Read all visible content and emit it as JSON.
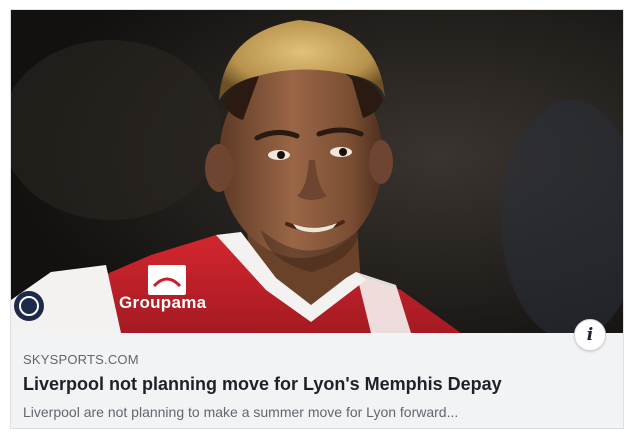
{
  "link_preview": {
    "domain": "SKYSPORTS.COM",
    "headline": "Liverpool not planning move for Lyon's Memphis Depay",
    "description": "Liverpool are not planning to make a summer move for Lyon forward...",
    "info_icon": "info-icon",
    "info_glyph": "i",
    "image": {
      "shirt_sponsor": "Groupama",
      "colors": {
        "shirt_red": "#c8202a",
        "shirt_white": "#f4f2f0",
        "skin": "#8a5a3e",
        "hair": "#c9a860",
        "background": "#1c1a17"
      }
    }
  }
}
